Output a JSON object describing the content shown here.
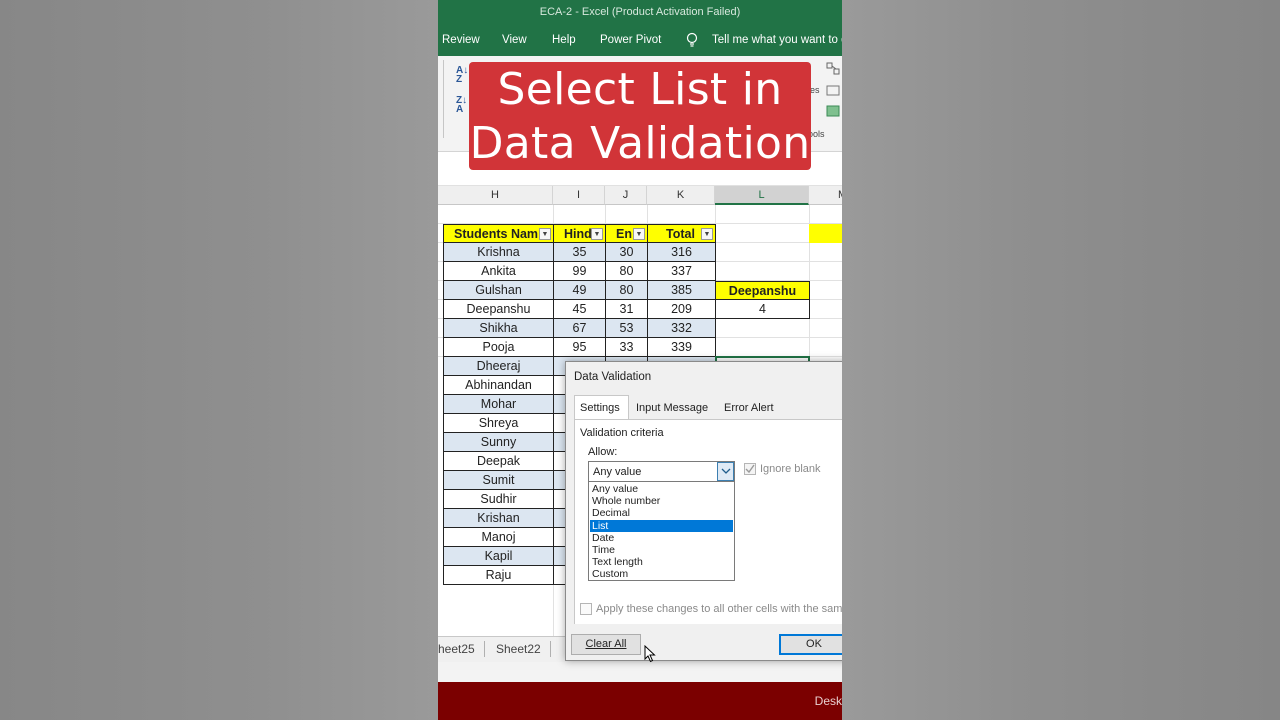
{
  "window": {
    "title": "ECA-2  -  Excel (Product Activation Failed)"
  },
  "ribbon": {
    "tabs": [
      "Review",
      "View",
      "Help",
      "Power Pivot"
    ],
    "tell_me": "Tell me what you want to do",
    "group_fragments": [
      "es",
      "ools"
    ]
  },
  "banner": {
    "line1": "Select List in",
    "line2": "Data Validation"
  },
  "columns": [
    "H",
    "I",
    "J",
    "K",
    "L",
    "M"
  ],
  "table": {
    "headers": [
      "Students Nam",
      "Hind",
      "En",
      "Total"
    ],
    "rows": [
      {
        "name": "Krishna",
        "hindi": "35",
        "english": "30",
        "total": "316"
      },
      {
        "name": "Ankita",
        "hindi": "99",
        "english": "80",
        "total": "337"
      },
      {
        "name": "Gulshan",
        "hindi": "49",
        "english": "80",
        "total": "385"
      },
      {
        "name": "Deepanshu",
        "hindi": "45",
        "english": "31",
        "total": "209"
      },
      {
        "name": "Shikha",
        "hindi": "67",
        "english": "53",
        "total": "332"
      },
      {
        "name": "Pooja",
        "hindi": "95",
        "english": "33",
        "total": "339"
      },
      {
        "name": "Dheeraj"
      },
      {
        "name": "Abhinandan"
      },
      {
        "name": "Mohar"
      },
      {
        "name": "Shreya"
      },
      {
        "name": "Sunny"
      },
      {
        "name": "Deepak"
      },
      {
        "name": "Sumit"
      },
      {
        "name": "Sudhir"
      },
      {
        "name": "Krishan"
      },
      {
        "name": "Manoj"
      },
      {
        "name": "Kapil"
      },
      {
        "name": "Raju"
      }
    ]
  },
  "lookup": {
    "name": "Deepanshu",
    "value": "4"
  },
  "sheet_tabs": [
    "heet25",
    "Sheet22"
  ],
  "taskbar": {
    "label": "Desk"
  },
  "dialog": {
    "title": "Data Validation",
    "tabs": [
      "Settings",
      "Input Message",
      "Error Alert"
    ],
    "criteria_label": "Validation criteria",
    "allow_label": "Allow:",
    "allow_value": "Any value",
    "ignore_blank": "Ignore blank",
    "options": [
      "Any value",
      "Whole number",
      "Decimal",
      "List",
      "Date",
      "Time",
      "Text length",
      "Custom"
    ],
    "selected_option": "List",
    "apply_label": "Apply these changes to all other cells with the same settings",
    "clear_all": "Clear All",
    "ok": "OK"
  },
  "colors": {
    "excel_green": "#217346",
    "banner_red": "#d13438",
    "header_yellow": "#ffff00",
    "band_blue": "#dce6f1",
    "selection_blue": "#0078d7"
  }
}
